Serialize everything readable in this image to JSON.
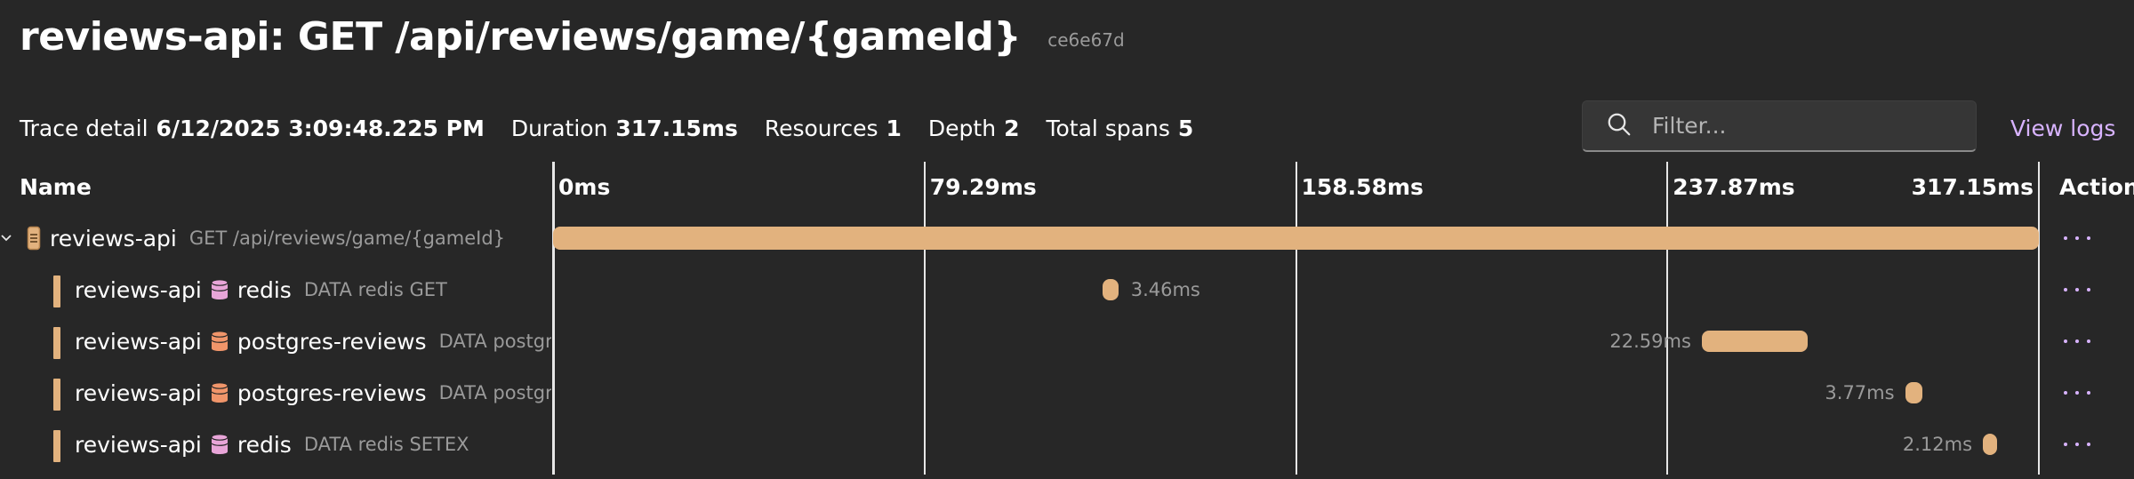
{
  "header": {
    "title": "reviews-api: GET /api/reviews/game/{gameId}",
    "trace_id": "ce6e67d"
  },
  "info": {
    "trace_detail_label": "Trace detail",
    "trace_detail_value": "6/12/2025 3:09:48.225 PM",
    "duration_label": "Duration",
    "duration_value": "317.15ms",
    "resources_label": "Resources",
    "resources_value": "1",
    "depth_label": "Depth",
    "depth_value": "2",
    "total_spans_label": "Total spans",
    "total_spans_value": "5"
  },
  "filter": {
    "placeholder": "Filter..."
  },
  "view_logs_label": "View logs",
  "columns": {
    "name": "Name",
    "actions": "Actions",
    "ticks": [
      "0ms",
      "79.29ms",
      "158.58ms",
      "237.87ms",
      "317.15ms"
    ]
  },
  "timeline": {
    "total_ms": 317.15
  },
  "colors": {
    "background": "#272727",
    "span_bar": "#e2b27e",
    "link_purple": "#d8b3ff",
    "redis_icon": "#e8a5d8",
    "postgres_icon": "#f0956a"
  },
  "spans": [
    {
      "resource": "reviews-api",
      "peer": "",
      "peer_icon": "",
      "detail": "GET /api/reviews/game/{gameId}",
      "start_ms": 0,
      "duration_ms": 317.15,
      "duration_label": "",
      "label_side": "none",
      "root": true
    },
    {
      "resource": "reviews-api",
      "peer": "redis",
      "peer_icon": "redis-icon",
      "detail": "DATA redis GET",
      "start_ms": 117.2,
      "duration_ms": 3.46,
      "duration_label": "3.46ms",
      "label_side": "right",
      "root": false
    },
    {
      "resource": "reviews-api",
      "peer": "postgres-reviews",
      "peer_icon": "postgres-icon",
      "detail": "DATA postgresql",
      "start_ms": 245.2,
      "duration_ms": 22.59,
      "duration_label": "22.59ms",
      "label_side": "left",
      "root": false
    },
    {
      "resource": "reviews-api",
      "peer": "postgres-reviews",
      "peer_icon": "postgres-icon",
      "detail": "DATA postgresql",
      "start_ms": 288.6,
      "duration_ms": 3.77,
      "duration_label": "3.77ms",
      "label_side": "left",
      "root": false
    },
    {
      "resource": "reviews-api",
      "peer": "redis",
      "peer_icon": "redis-icon",
      "detail": "DATA redis SETEX",
      "start_ms": 305.2,
      "duration_ms": 2.12,
      "duration_label": "2.12ms",
      "label_side": "left",
      "root": false
    }
  ]
}
